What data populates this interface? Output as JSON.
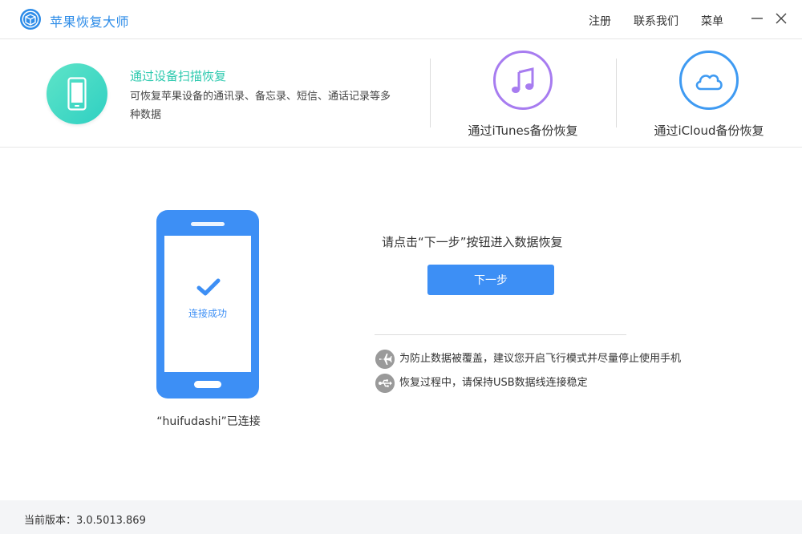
{
  "app": {
    "title": "苹果恢复大师",
    "menu": {
      "register": "注册",
      "contact": "联系我们",
      "menu": "菜单"
    }
  },
  "modes": {
    "scan": {
      "title": "通过设备扫描恢复",
      "desc": "可恢复苹果设备的通讯录、备忘录、短信、通话记录等多种数据",
      "icon": "phone-icon"
    },
    "itunes": {
      "label": "通过iTunes备份恢复",
      "icon": "music-note-icon"
    },
    "icloud": {
      "label": "通过iCloud备份恢复",
      "icon": "cloud-icon"
    }
  },
  "device": {
    "status": "连接成功",
    "caption": "“huifudashi”已连接"
  },
  "main": {
    "prompt": "请点击“下一步”按钮进入数据恢复",
    "next_button": "下一步",
    "tips": [
      {
        "icon": "airplane-icon",
        "text": "为防止数据被覆盖，建议您开启飞行模式并尽量停止使用手机"
      },
      {
        "icon": "usb-icon",
        "text": "恢复过程中，请保持USB数据线连接稳定"
      }
    ]
  },
  "footer": {
    "version": "当前版本：3.0.5013.869"
  },
  "colors": {
    "accent": "#3d8ff5",
    "brand_blue": "#2d8ce8",
    "scan_green": "#2cc9ae",
    "itunes_purple": "#a77cf0",
    "icloud_blue": "#3e9af2"
  }
}
